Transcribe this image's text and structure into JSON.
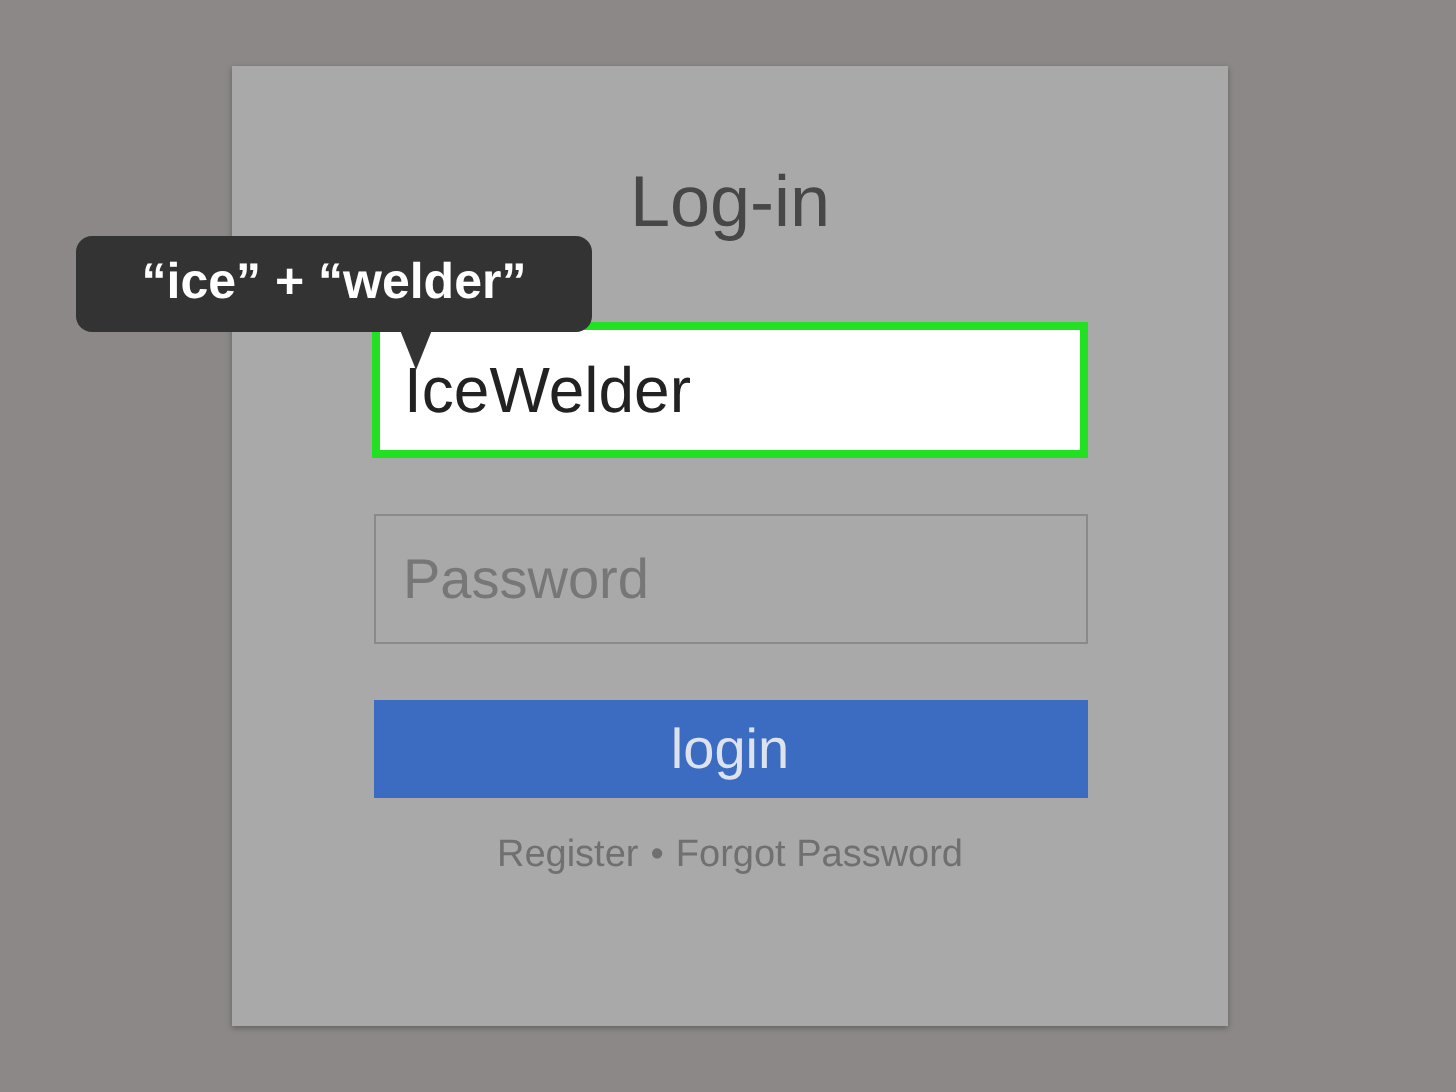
{
  "title": "Log-in",
  "callout": {
    "text": "“ice” + “welder”"
  },
  "username": {
    "value": "IceWelder",
    "focused": true
  },
  "password": {
    "placeholder": "Password"
  },
  "button": {
    "label": "login"
  },
  "links": [
    {
      "label": "Register"
    },
    {
      "label": "Forgot Password"
    }
  ],
  "separator": "•"
}
